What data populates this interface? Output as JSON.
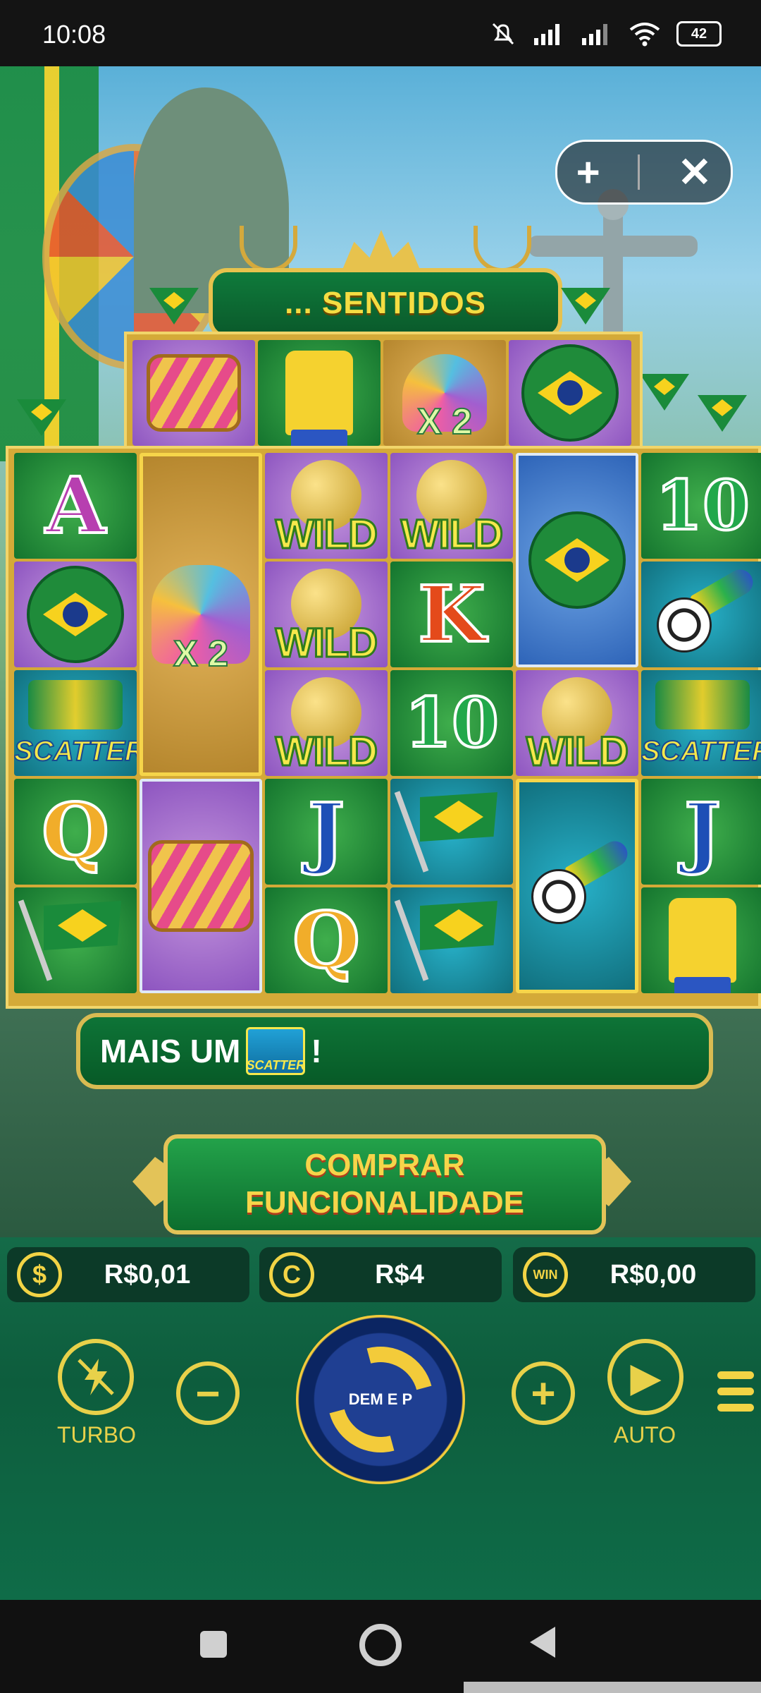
{
  "status_bar": {
    "time": "10:08",
    "battery": "42"
  },
  "overlay": {
    "plus_icon": "+",
    "close_icon": "✕"
  },
  "banner": {
    "title": "...  SENTIDOS"
  },
  "top_row": [
    {
      "symbol": "drum",
      "bg": "purple"
    },
    {
      "symbol": "jersey",
      "bg": "green"
    },
    {
      "symbol": "feathers",
      "bg": "gold",
      "mult": "X 2"
    },
    {
      "symbol": "ball-flag",
      "bg": "purple"
    }
  ],
  "grid": {
    "letters": {
      "A": "A",
      "K": "K",
      "Q": "Q",
      "J": "J",
      "ten": "10"
    },
    "wild": "WILD",
    "scatter": "SCATTER",
    "mult": "X 2"
  },
  "message": {
    "prefix": "MAIS UM",
    "scatter_label": "SCATTER",
    "suffix": "!"
  },
  "buy_feature": {
    "line1": "COMPRAR",
    "line2": "FUNCIONALIDADE"
  },
  "balances": {
    "balance": {
      "icon": "$",
      "value": "R$0,01"
    },
    "bet": {
      "icon": "C",
      "value": "R$4"
    },
    "win": {
      "icon": "WIN",
      "value": "R$0,00"
    }
  },
  "controls": {
    "turbo": "TURBO",
    "auto": "AUTO",
    "spin_text": "DEM E P",
    "minus": "−",
    "plus": "+",
    "play": "▶"
  },
  "colors": {
    "gold": "#e8d14a",
    "green": "#0d5d3d",
    "frame": "#d4aa38"
  }
}
